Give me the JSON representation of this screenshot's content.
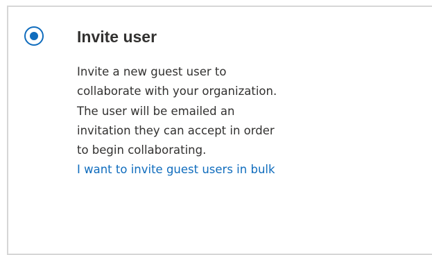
{
  "option": {
    "selected": true,
    "title": "Invite user",
    "description_lines": [
      "Invite a new guest user to",
      "collaborate with your organization.",
      "The user will be emailed an",
      "invitation they can accept in order",
      "to begin collaborating."
    ],
    "bulk_link": "I want to invite guest users in bulk"
  },
  "colors": {
    "accent": "#0f6cbd",
    "text": "#323130",
    "border": "#d6d6d6"
  }
}
